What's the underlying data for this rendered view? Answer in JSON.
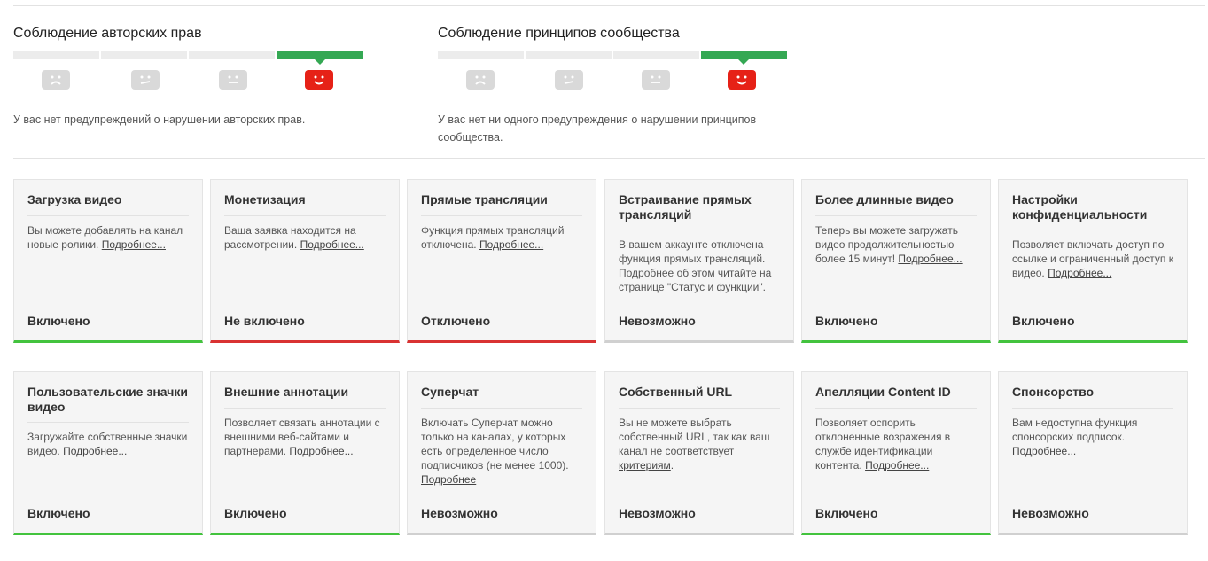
{
  "copyright": {
    "title": "Соблюдение авторских прав",
    "message": "У вас нет предупреждений о нарушении авторских прав."
  },
  "community": {
    "title": "Соблюдение принципов сообщества",
    "message": "У вас нет ни одного предупреждения о нарушении принципов сообщества."
  },
  "strike_faces": [
    "sad-face-icon",
    "meh-face-icon",
    "neutral-face-icon",
    "happy-face-icon"
  ],
  "colors": {
    "accent_green": "#34a853",
    "status_on": "#43c33e",
    "status_off": "#d93232",
    "face_red": "#e62117"
  },
  "features": [
    {
      "title": "Загрузка видео",
      "desc": "Вы можете добавлять на канал новые ролики.",
      "more": "Подробнее...",
      "status": "Включено",
      "state": "on"
    },
    {
      "title": "Монетизация",
      "desc": "Ваша заявка находится на рассмотрении.",
      "more": "Подробнее...",
      "status": "Не включено",
      "state": "off"
    },
    {
      "title": "Прямые трансляции",
      "desc": "Функция прямых трансляций отключена.",
      "more": "Подробнее...",
      "status": "Отключено",
      "state": "off"
    },
    {
      "title": "Встраивание прямых трансляций",
      "desc": "В вашем аккаунте отключена функция прямых трансляций. Подробнее об этом читайте на странице \"Статус и функции\".",
      "more": "",
      "status": "Невозможно",
      "state": "na"
    },
    {
      "title": "Более длинные видео",
      "desc": "Теперь вы можете загружать видео продолжительностью более 15 минут!",
      "more": "Подробнее...",
      "status": "Включено",
      "state": "on"
    },
    {
      "title": "Настройки конфиденциальности",
      "desc": "Позволяет включать доступ по ссылке и ограниченный доступ к видео.",
      "more": "Подробнее...",
      "status": "Включено",
      "state": "on"
    },
    {
      "title": "Пользовательские значки видео",
      "desc": "Загружайте собственные значки видео.",
      "more": "Подробнее...",
      "status": "Включено",
      "state": "on"
    },
    {
      "title": "Внешние аннотации",
      "desc": "Позволяет связать аннотации с внешними веб-сайтами и партнерами.",
      "more": "Подробнее...",
      "status": "Включено",
      "state": "on"
    },
    {
      "title": "Суперчат",
      "desc": "Включать Суперчат можно только на каналах, у которых есть определенное число подписчиков (не менее 1000).",
      "more": "Подробнее",
      "status": "Невозможно",
      "state": "na"
    },
    {
      "title": "Собственный URL",
      "desc": "Вы не можете выбрать собственный URL, так как ваш канал не соответствует",
      "more": "критериям",
      "tail": ".",
      "status": "Невозможно",
      "state": "na"
    },
    {
      "title": "Апелляции Content ID",
      "desc": "Позволяет оспорить отклоненные возражения в службе идентификации контента.",
      "more": "Подробнее...",
      "status": "Включено",
      "state": "on"
    },
    {
      "title": "Спонсорство",
      "desc": "Вам недоступна функция спонсорских подписок.",
      "more": "Подробнее...",
      "status": "Невозможно",
      "state": "na"
    }
  ]
}
